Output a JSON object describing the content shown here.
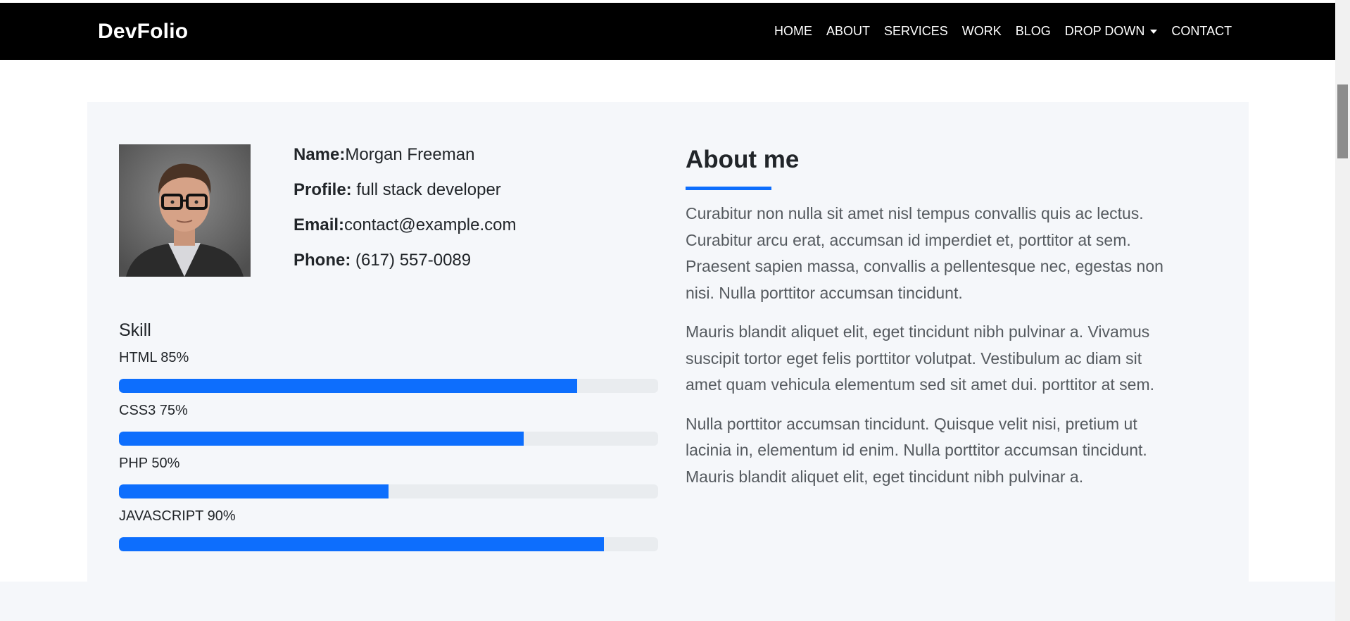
{
  "header": {
    "brand": "DevFolio",
    "nav": [
      {
        "label": "HOME"
      },
      {
        "label": "ABOUT"
      },
      {
        "label": "SERVICES"
      },
      {
        "label": "WORK"
      },
      {
        "label": "BLOG"
      },
      {
        "label": "DROP DOWN",
        "has_dropdown": true
      },
      {
        "label": "CONTACT"
      }
    ]
  },
  "profile": {
    "name_label": "Name:",
    "name_value": "Morgan Freeman",
    "profile_label": "Profile:",
    "profile_value": " full stack developer",
    "email_label": "Email:",
    "email_value": "contact@example.com",
    "phone_label": "Phone:",
    "phone_value": " (617) 557-0089"
  },
  "skills": {
    "title": "Skill",
    "items": [
      {
        "label": "HTML 85%",
        "percent": 85
      },
      {
        "label": "CSS3 75%",
        "percent": 75
      },
      {
        "label": "PHP 50%",
        "percent": 50
      },
      {
        "label": "JAVASCRIPT 90%",
        "percent": 90
      }
    ]
  },
  "about": {
    "heading": "About me",
    "paragraphs": [
      "Curabitur non nulla sit amet nisl tempus convallis quis ac lectus. Curabitur arcu erat, accumsan id imperdiet et, porttitor at sem. Praesent sapien massa, convallis a pellentesque nec, egestas non nisi. Nulla porttitor accumsan tincidunt.",
      "Mauris blandit aliquet elit, eget tincidunt nibh pulvinar a. Vivamus suscipit tortor eget felis porttitor volutpat. Vestibulum ac diam sit amet quam vehicula elementum sed sit amet dui. porttitor at sem.",
      "Nulla porttitor accumsan tincidunt. Quisque velit nisi, pretium ut lacinia in, elementum id enim. Nulla porttitor accumsan tincidunt. Mauris blandit aliquet elit, eget tincidunt nibh pulvinar a."
    ]
  },
  "colors": {
    "accent": "#0d6efd",
    "header_bg": "#000000",
    "card_bg": "#f5f7fa",
    "track_bg": "#e9ecef"
  }
}
